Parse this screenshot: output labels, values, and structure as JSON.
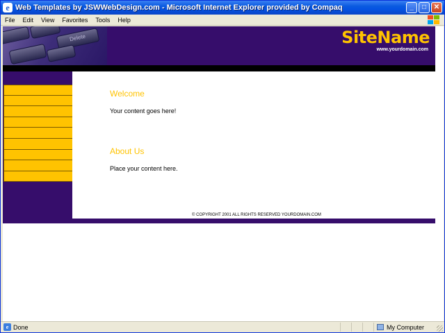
{
  "window": {
    "title": "Web Templates by JSWWebDesign.com - Microsoft Internet Explorer provided by Compaq",
    "buttons": {
      "minimize": "_",
      "maximize": "□",
      "close": "✕"
    }
  },
  "menu": [
    "File",
    "Edit",
    "View",
    "Favorites",
    "Tools",
    "Help"
  ],
  "site": {
    "name": "SiteName",
    "domain": "www.yourdomain.com",
    "keyboard_key": "Delete",
    "nav_items": [
      "",
      "",
      "",
      "",
      "",
      "",
      "",
      "",
      "",
      ""
    ],
    "sections": [
      {
        "heading": "Welcome",
        "body": "Your content goes here!"
      },
      {
        "heading": "About Us",
        "body": "Place your content here."
      }
    ],
    "copyright": "© COPYRIGHT 2001 ALL RIGHTS RESERVED YOURDOMAIN.COM"
  },
  "status": {
    "text": "Done",
    "zone": "My Computer"
  },
  "colors": {
    "brand_purple": "#360d6b",
    "accent_gold": "#ffc300",
    "title_blue": "#0a5adf"
  },
  "icons": [
    "ie-icon",
    "minimize-icon",
    "maximize-icon",
    "close-icon",
    "windows-logo-icon",
    "page-done-icon",
    "my-computer-icon"
  ]
}
